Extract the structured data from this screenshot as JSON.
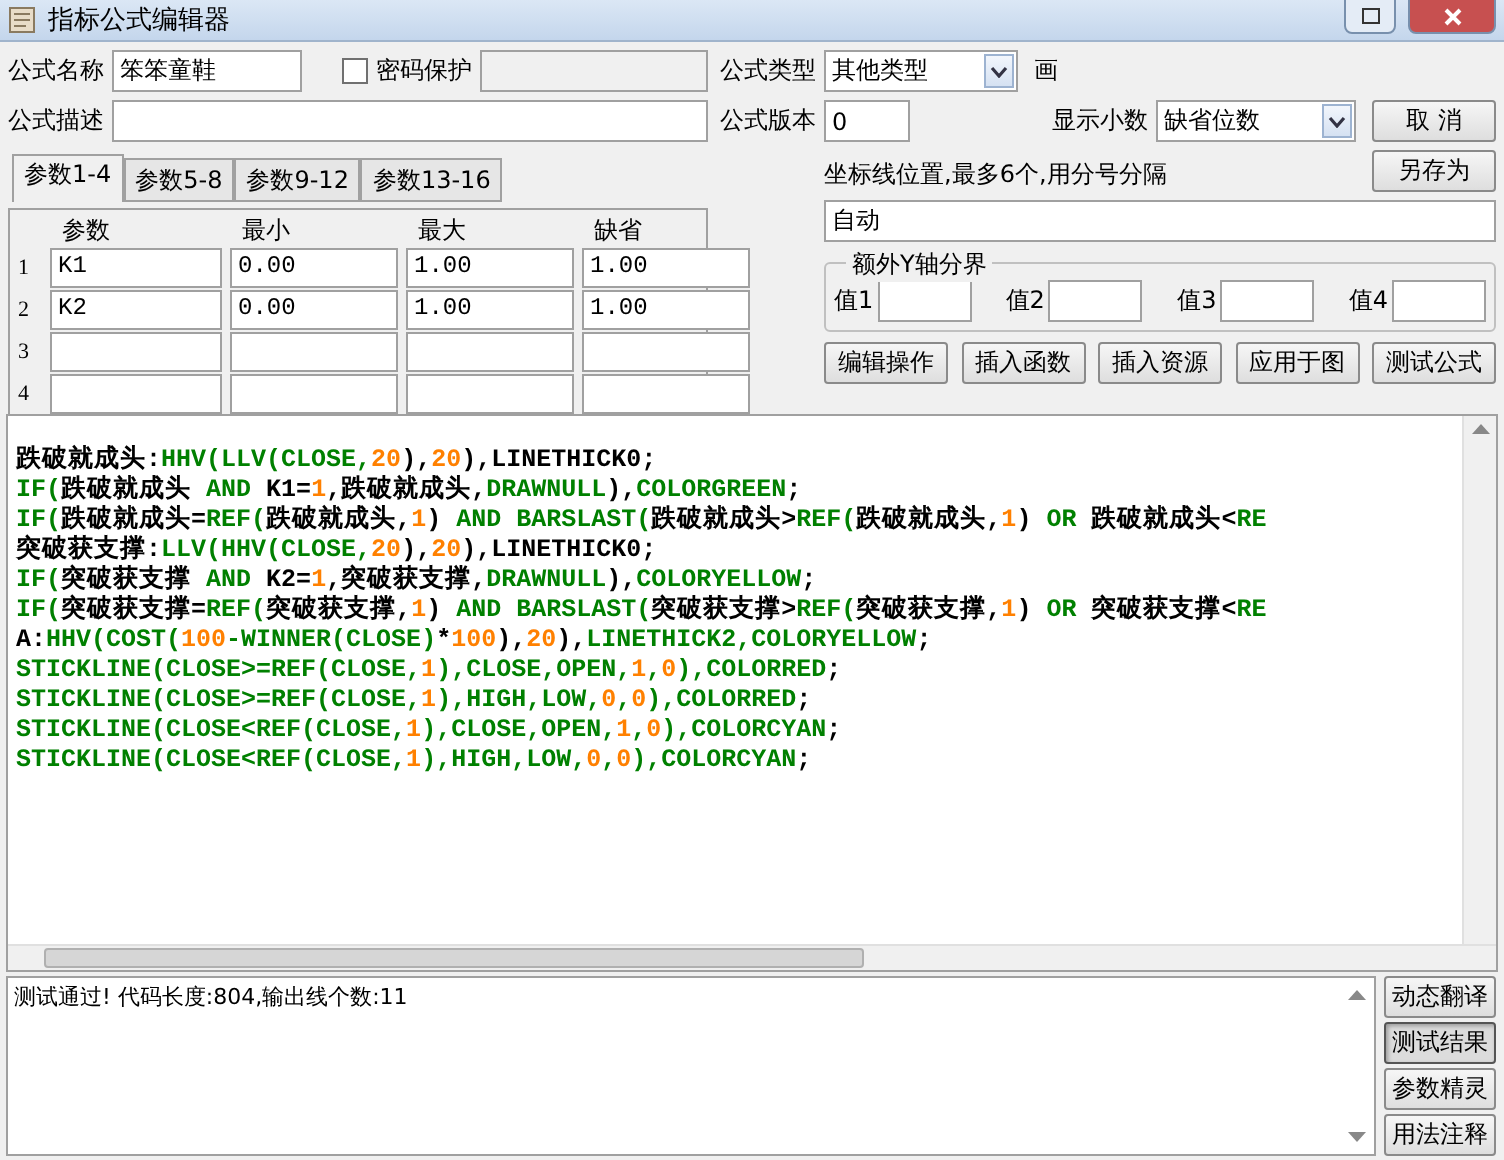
{
  "window": {
    "title": "指标公式编辑器"
  },
  "name_row": {
    "label": "公式名称",
    "value": "笨笨童鞋",
    "password": {
      "label": "密码保护",
      "checked": false
    }
  },
  "desc_row": {
    "label": "公式描述"
  },
  "type_row": {
    "label": "公式类型",
    "value": "其他类型",
    "draw_label": "画"
  },
  "version_row": {
    "label": "公式版本",
    "value": "0",
    "decimals_label": "显示小数",
    "decimals_value": "缺省位数"
  },
  "side_buttons": [
    "取 消",
    "另存为"
  ],
  "tabs": [
    {
      "label": "参数1-4",
      "selected": true
    },
    {
      "label": "参数5-8",
      "selected": false
    },
    {
      "label": "参数9-12",
      "selected": false
    },
    {
      "label": "参数13-16",
      "selected": false
    }
  ],
  "params": {
    "columns": [
      "参数",
      "最小",
      "最大",
      "缺省"
    ],
    "rows": [
      {
        "index": "1",
        "values": [
          "K1",
          "0.00",
          "1.00",
          "1.00"
        ]
      },
      {
        "index": "2",
        "values": [
          "K2",
          "0.00",
          "1.00",
          "1.00"
        ]
      },
      {
        "index": "3"
      },
      {
        "index": "4"
      }
    ]
  },
  "axis": {
    "label": "坐标线位置,最多6个,用分号分隔",
    "value": "自动"
  },
  "y_bounds": {
    "title": "额外Y轴分界",
    "fields": [
      "值1",
      "值2",
      "值3",
      "值4"
    ]
  },
  "action_buttons": [
    "编辑操作",
    "插入函数",
    "插入资源",
    "应用于图",
    "测试公式"
  ],
  "code": [
    [
      {
        "kind": "plain",
        "s": "跌破就成头:"
      },
      {
        "kind": "function",
        "s": "HHV(LLV(CLOSE,"
      },
      {
        "kind": "number",
        "s": "20"
      },
      {
        "kind": "plain",
        "s": "),"
      },
      {
        "kind": "number",
        "s": "20"
      },
      {
        "kind": "plain",
        "s": "),LINETHICK0;"
      }
    ],
    [
      {
        "kind": "function",
        "s": "IF("
      },
      {
        "kind": "plain",
        "s": "跌破就成头 "
      },
      {
        "kind": "function",
        "s": "AND"
      },
      {
        "kind": "plain",
        "s": " K1="
      },
      {
        "kind": "number",
        "s": "1"
      },
      {
        "kind": "plain",
        "s": ",跌破就成头,"
      },
      {
        "kind": "function",
        "s": "DRAWNULL"
      },
      {
        "kind": "plain",
        "s": "),"
      },
      {
        "kind": "function",
        "s": "COLORGREEN"
      },
      {
        "kind": "plain",
        "s": ";"
      }
    ],
    [
      {
        "kind": "function",
        "s": "IF("
      },
      {
        "kind": "plain",
        "s": "跌破就成头="
      },
      {
        "kind": "function",
        "s": "REF("
      },
      {
        "kind": "plain",
        "s": "跌破就成头,"
      },
      {
        "kind": "number",
        "s": "1"
      },
      {
        "kind": "plain",
        "s": ") "
      },
      {
        "kind": "function",
        "s": "AND BARSLAST("
      },
      {
        "kind": "plain",
        "s": "跌破就成头>"
      },
      {
        "kind": "function",
        "s": "REF("
      },
      {
        "kind": "plain",
        "s": "跌破就成头,"
      },
      {
        "kind": "number",
        "s": "1"
      },
      {
        "kind": "plain",
        "s": ") "
      },
      {
        "kind": "function",
        "s": "OR"
      },
      {
        "kind": "plain",
        "s": " 跌破就成头<"
      },
      {
        "kind": "function",
        "s": "RE"
      }
    ],
    [
      {
        "kind": "plain",
        "s": "突破获支撑:"
      },
      {
        "kind": "function",
        "s": "LLV(HHV(CLOSE,"
      },
      {
        "kind": "number",
        "s": "20"
      },
      {
        "kind": "plain",
        "s": "),"
      },
      {
        "kind": "number",
        "s": "20"
      },
      {
        "kind": "plain",
        "s": "),LINETHICK0;"
      }
    ],
    [
      {
        "kind": "function",
        "s": "IF("
      },
      {
        "kind": "plain",
        "s": "突破获支撑 "
      },
      {
        "kind": "function",
        "s": "AND"
      },
      {
        "kind": "plain",
        "s": " K2="
      },
      {
        "kind": "number",
        "s": "1"
      },
      {
        "kind": "plain",
        "s": ",突破获支撑,"
      },
      {
        "kind": "function",
        "s": "DRAWNULL"
      },
      {
        "kind": "plain",
        "s": "),"
      },
      {
        "kind": "function",
        "s": "COLORYELLOW"
      },
      {
        "kind": "plain",
        "s": ";"
      }
    ],
    [
      {
        "kind": "function",
        "s": "IF("
      },
      {
        "kind": "plain",
        "s": "突破获支撑="
      },
      {
        "kind": "function",
        "s": "REF("
      },
      {
        "kind": "plain",
        "s": "突破获支撑,"
      },
      {
        "kind": "number",
        "s": "1"
      },
      {
        "kind": "plain",
        "s": ") "
      },
      {
        "kind": "function",
        "s": "AND BARSLAST("
      },
      {
        "kind": "plain",
        "s": "突破获支撑>"
      },
      {
        "kind": "function",
        "s": "REF("
      },
      {
        "kind": "plain",
        "s": "突破获支撑,"
      },
      {
        "kind": "number",
        "s": "1"
      },
      {
        "kind": "plain",
        "s": ") "
      },
      {
        "kind": "function",
        "s": "OR"
      },
      {
        "kind": "plain",
        "s": " 突破获支撑<"
      },
      {
        "kind": "function",
        "s": "RE"
      }
    ],
    [
      {
        "kind": "plain",
        "s": "A:"
      },
      {
        "kind": "function",
        "s": "HHV(COST("
      },
      {
        "kind": "number",
        "s": "100"
      },
      {
        "kind": "function",
        "s": "-WINNER(CLOSE)"
      },
      {
        "kind": "plain",
        "s": "*"
      },
      {
        "kind": "number",
        "s": "100"
      },
      {
        "kind": "plain",
        "s": "),"
      },
      {
        "kind": "number",
        "s": "20"
      },
      {
        "kind": "plain",
        "s": "),"
      },
      {
        "kind": "function",
        "s": "LINETHICK2,COLORYELLOW"
      },
      {
        "kind": "plain",
        "s": ";"
      }
    ],
    [
      {
        "kind": "function",
        "s": "STICKLINE(CLOSE>=REF(CLOSE,"
      },
      {
        "kind": "number",
        "s": "1"
      },
      {
        "kind": "function",
        "s": "),CLOSE,OPEN,"
      },
      {
        "kind": "number",
        "s": "1"
      },
      {
        "kind": "function",
        "s": ","
      },
      {
        "kind": "number",
        "s": "0"
      },
      {
        "kind": "function",
        "s": "),COLORRED"
      },
      {
        "kind": "plain",
        "s": ";"
      }
    ],
    [
      {
        "kind": "function",
        "s": "STICKLINE(CLOSE>=REF(CLOSE,"
      },
      {
        "kind": "number",
        "s": "1"
      },
      {
        "kind": "function",
        "s": "),HIGH,LOW,"
      },
      {
        "kind": "number",
        "s": "0"
      },
      {
        "kind": "function",
        "s": ","
      },
      {
        "kind": "number",
        "s": "0"
      },
      {
        "kind": "function",
        "s": "),COLORRED"
      },
      {
        "kind": "plain",
        "s": ";"
      }
    ],
    [
      {
        "kind": "function",
        "s": "STICKLINE(CLOSE<REF(CLOSE,"
      },
      {
        "kind": "number",
        "s": "1"
      },
      {
        "kind": "function",
        "s": "),CLOSE,OPEN,"
      },
      {
        "kind": "number",
        "s": "1"
      },
      {
        "kind": "function",
        "s": ","
      },
      {
        "kind": "number",
        "s": "0"
      },
      {
        "kind": "function",
        "s": "),COLORCYAN"
      },
      {
        "kind": "plain",
        "s": ";"
      }
    ],
    [
      {
        "kind": "function",
        "s": "STICKLINE(CLOSE<REF(CLOSE,"
      },
      {
        "kind": "number",
        "s": "1"
      },
      {
        "kind": "function",
        "s": "),HIGH,LOW,"
      },
      {
        "kind": "number",
        "s": "0"
      },
      {
        "kind": "function",
        "s": ","
      },
      {
        "kind": "number",
        "s": "0"
      },
      {
        "kind": "function",
        "s": "),COLORCYAN"
      },
      {
        "kind": "plain",
        "s": ";"
      }
    ]
  ],
  "output": "测试通过! 代码长度:804,输出线个数:11",
  "output_buttons": [
    {
      "label": "动态翻译",
      "selected": false
    },
    {
      "label": "测试结果",
      "selected": true
    },
    {
      "label": "参数精灵",
      "selected": false
    },
    {
      "label": "用法注释",
      "selected": false
    }
  ]
}
